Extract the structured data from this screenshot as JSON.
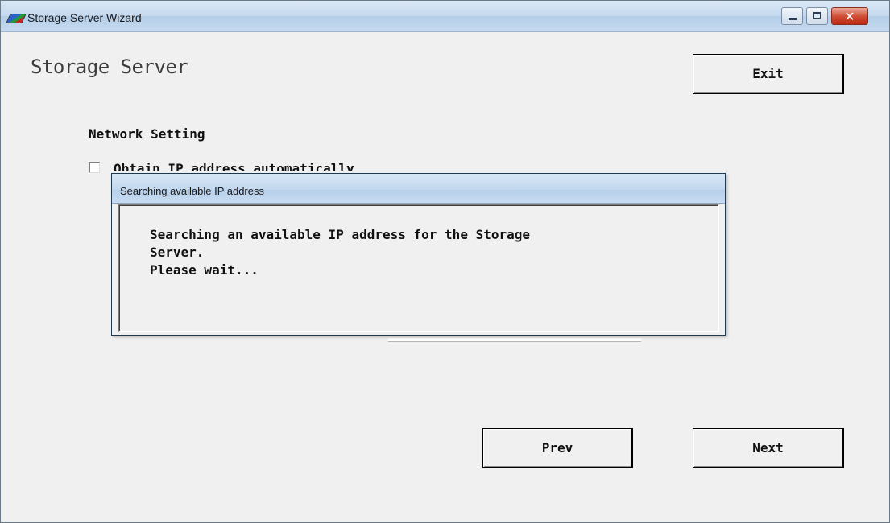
{
  "window": {
    "title": "Storage Server Wizard",
    "icon": "storage-app-icon",
    "controls": {
      "minimize": "minimize-icon",
      "maximize": "maximize-icon",
      "close": "close-icon",
      "close_glyph": "✕"
    }
  },
  "main": {
    "heading": "Storage Server",
    "exit_label": "Exit",
    "section_label": "Network Setting",
    "auto_ip_checkbox": {
      "label": "Obtain IP address automatically",
      "checked": false
    },
    "prev_label": "Prev",
    "next_label": "Next"
  },
  "dialog": {
    "title": "Searching available IP address",
    "message": "Searching an available IP address for the Storage\nServer.\nPlease wait..."
  },
  "colors": {
    "titlebar": "#c4d8ee",
    "close_button": "#cf4a31",
    "window_background": "#f0f0f0"
  }
}
